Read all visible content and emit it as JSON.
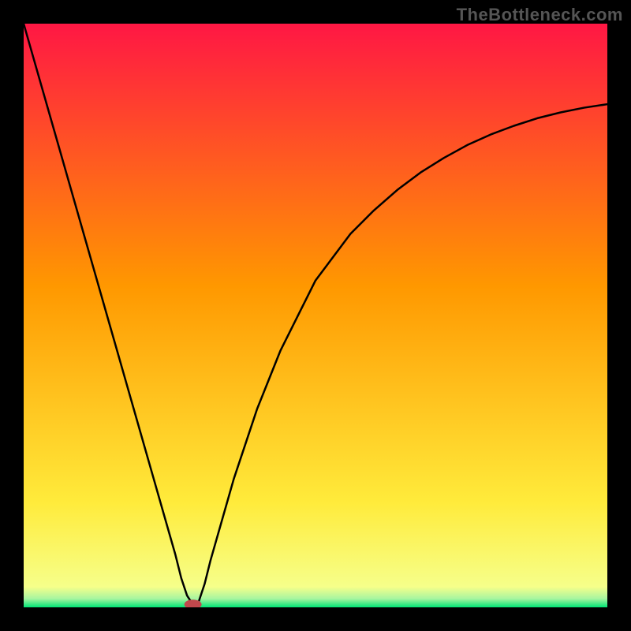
{
  "watermark": "TheBottleneck.com",
  "chart_data": {
    "type": "line",
    "title": "",
    "xlabel": "",
    "ylabel": "",
    "xlim": [
      0,
      100
    ],
    "ylim": [
      0,
      100
    ],
    "background_gradient": {
      "top": "#ff1744",
      "mid1": "#ff9800",
      "mid2": "#ffeb3b",
      "bottom": "#00e676"
    },
    "series": [
      {
        "name": "bottleneck-curve",
        "x": [
          0,
          2,
          4,
          6,
          8,
          10,
          12,
          14,
          16,
          18,
          20,
          22,
          24,
          26,
          27,
          28,
          29,
          30,
          31,
          32,
          34,
          36,
          38,
          40,
          42,
          44,
          46,
          48,
          50,
          53,
          56,
          60,
          64,
          68,
          72,
          76,
          80,
          84,
          88,
          92,
          96,
          100
        ],
        "y": [
          100,
          93,
          86,
          79,
          72,
          65,
          58,
          51,
          44,
          37,
          30,
          23,
          16,
          9,
          5,
          2,
          0.5,
          1,
          4,
          8,
          15,
          22,
          28,
          34,
          39,
          44,
          48,
          52,
          56,
          60,
          64,
          68,
          71.5,
          74.5,
          77,
          79.2,
          81,
          82.5,
          83.8,
          84.8,
          85.6,
          86.2
        ]
      }
    ],
    "marker": {
      "name": "bottleneck-point",
      "x": 29,
      "y": 0.5,
      "color": "#c1484d"
    }
  }
}
